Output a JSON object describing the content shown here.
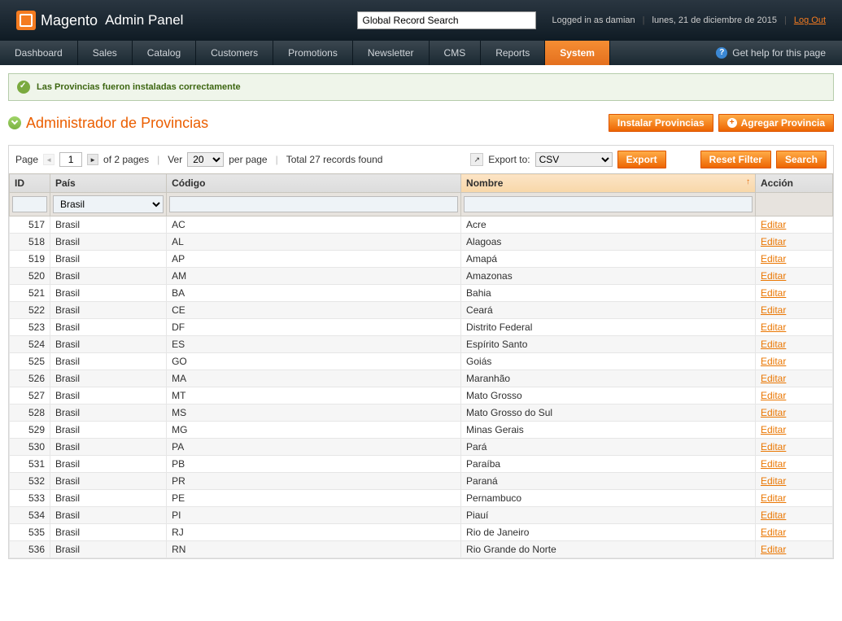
{
  "header": {
    "brand1": "Magento",
    "brand2": "Admin Panel",
    "search_placeholder": "Global Record Search",
    "logged_in": "Logged in as damian",
    "date": "lunes, 21 de diciembre de 2015",
    "logout": "Log Out"
  },
  "nav": {
    "items": [
      "Dashboard",
      "Sales",
      "Catalog",
      "Customers",
      "Promotions",
      "Newsletter",
      "CMS",
      "Reports",
      "System"
    ],
    "active": "System",
    "help": "Get help for this page"
  },
  "message": "Las Provincias fueron instaladas correctamente",
  "title": "Administrador de Provincias",
  "buttons": {
    "install": "Instalar Provincias",
    "add": "Agregar Provincia"
  },
  "controls": {
    "page_label": "Page",
    "page_value": "1",
    "of_pages": "of 2 pages",
    "view_label": "Ver",
    "view_value": "20",
    "per_page": "per page",
    "total": "Total 27 records found",
    "export_label": "Export to:",
    "export_value": "CSV",
    "export_btn": "Export",
    "reset": "Reset Filter",
    "search": "Search"
  },
  "columns": {
    "id": "ID",
    "pais": "País",
    "codigo": "Código",
    "nombre": "Nombre",
    "accion": "Acción"
  },
  "filter": {
    "pais": "Brasil"
  },
  "action_label": "Editar",
  "rows": [
    {
      "id": "517",
      "pais": "Brasil",
      "codigo": "AC",
      "nombre": "Acre"
    },
    {
      "id": "518",
      "pais": "Brasil",
      "codigo": "AL",
      "nombre": "Alagoas"
    },
    {
      "id": "519",
      "pais": "Brasil",
      "codigo": "AP",
      "nombre": "Amapá"
    },
    {
      "id": "520",
      "pais": "Brasil",
      "codigo": "AM",
      "nombre": "Amazonas"
    },
    {
      "id": "521",
      "pais": "Brasil",
      "codigo": "BA",
      "nombre": "Bahia"
    },
    {
      "id": "522",
      "pais": "Brasil",
      "codigo": "CE",
      "nombre": "Ceará"
    },
    {
      "id": "523",
      "pais": "Brasil",
      "codigo": "DF",
      "nombre": "Distrito Federal"
    },
    {
      "id": "524",
      "pais": "Brasil",
      "codigo": "ES",
      "nombre": "Espírito Santo"
    },
    {
      "id": "525",
      "pais": "Brasil",
      "codigo": "GO",
      "nombre": "Goiás"
    },
    {
      "id": "526",
      "pais": "Brasil",
      "codigo": "MA",
      "nombre": "Maranhão"
    },
    {
      "id": "527",
      "pais": "Brasil",
      "codigo": "MT",
      "nombre": "Mato Grosso"
    },
    {
      "id": "528",
      "pais": "Brasil",
      "codigo": "MS",
      "nombre": "Mato Grosso do Sul"
    },
    {
      "id": "529",
      "pais": "Brasil",
      "codigo": "MG",
      "nombre": "Minas Gerais"
    },
    {
      "id": "530",
      "pais": "Brasil",
      "codigo": "PA",
      "nombre": "Pará"
    },
    {
      "id": "531",
      "pais": "Brasil",
      "codigo": "PB",
      "nombre": "Paraíba"
    },
    {
      "id": "532",
      "pais": "Brasil",
      "codigo": "PR",
      "nombre": "Paraná"
    },
    {
      "id": "533",
      "pais": "Brasil",
      "codigo": "PE",
      "nombre": "Pernambuco"
    },
    {
      "id": "534",
      "pais": "Brasil",
      "codigo": "PI",
      "nombre": "Piauí"
    },
    {
      "id": "535",
      "pais": "Brasil",
      "codigo": "RJ",
      "nombre": "Rio de Janeiro"
    },
    {
      "id": "536",
      "pais": "Brasil",
      "codigo": "RN",
      "nombre": "Rio Grande do Norte"
    }
  ]
}
